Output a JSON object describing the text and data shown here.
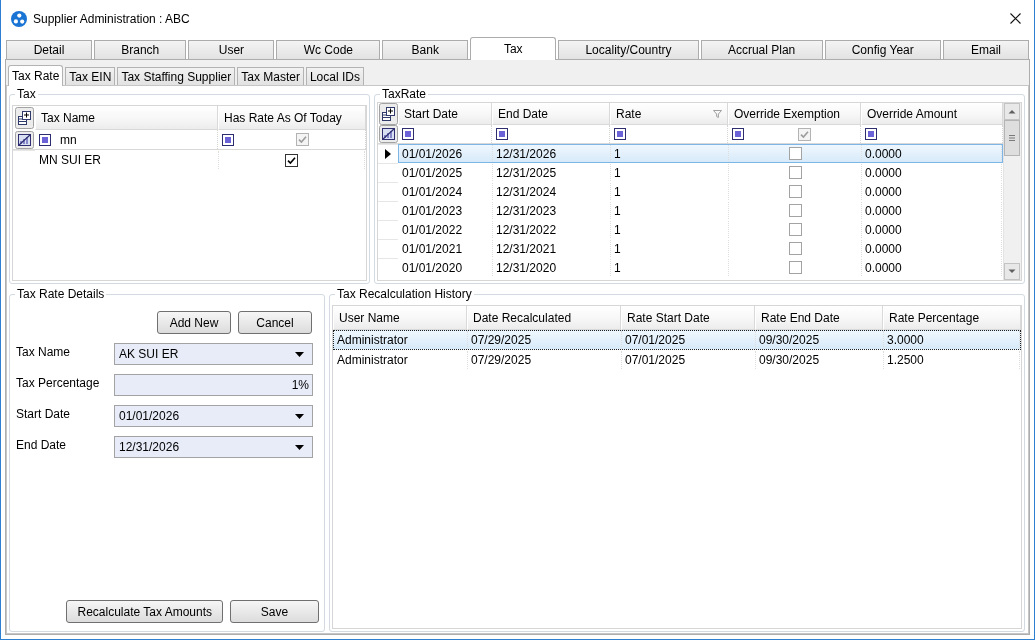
{
  "window": {
    "title": "Supplier Administration : ABC"
  },
  "tabs": [
    {
      "label": "Detail",
      "selected": false
    },
    {
      "label": "Branch",
      "selected": false
    },
    {
      "label": "User",
      "selected": false
    },
    {
      "label": "Wc Code",
      "selected": false
    },
    {
      "label": "Bank",
      "selected": false
    },
    {
      "label": "Tax",
      "selected": true
    },
    {
      "label": "Locality/Country",
      "selected": false
    },
    {
      "label": "Accrual Plan",
      "selected": false
    },
    {
      "label": "Config Year",
      "selected": false
    },
    {
      "label": "Email",
      "selected": false
    }
  ],
  "sub_tabs": [
    {
      "label": "Tax Rate",
      "selected": true
    },
    {
      "label": "Tax EIN",
      "selected": false
    },
    {
      "label": "Tax Staffing Supplier",
      "selected": false
    },
    {
      "label": "Tax Master",
      "selected": false
    },
    {
      "label": "Local IDs",
      "selected": false
    }
  ],
  "tax": {
    "title": "Tax",
    "grid": {
      "columns": [
        {
          "label": "Tax Name",
          "kind": "text",
          "filter_button": false
        },
        {
          "label": "Has Rate As Of Today",
          "kind": "checkbox",
          "filter_button": false
        }
      ],
      "filters": [
        {
          "kind": "text",
          "value": "mn"
        },
        {
          "kind": "checkbox",
          "checked": true
        }
      ],
      "rows": [
        {
          "selected": false,
          "cells": [
            "MN SUI ER",
            {
              "checked": true
            }
          ]
        }
      ]
    }
  },
  "tax_rate": {
    "title": "TaxRate",
    "grid": {
      "columns": [
        {
          "label": "Start Date",
          "kind": "text",
          "filter_button": false
        },
        {
          "label": "End Date",
          "kind": "text",
          "filter_button": false
        },
        {
          "label": "Rate",
          "kind": "text",
          "filter_button": true
        },
        {
          "label": "Override Exemption",
          "kind": "checkbox",
          "filter_button": false
        },
        {
          "label": "Override Amount",
          "kind": "text",
          "filter_button": false
        }
      ],
      "filters": [
        {
          "kind": "text"
        },
        {
          "kind": "text"
        },
        {
          "kind": "text"
        },
        {
          "kind": "checkbox",
          "checked": true
        },
        {
          "kind": "text"
        }
      ],
      "rows": [
        {
          "selected": true,
          "cells": [
            "01/01/2026",
            "12/31/2026",
            "1",
            {
              "checked": false
            },
            "0.0000"
          ]
        },
        {
          "selected": false,
          "cells": [
            "01/01/2025",
            "12/31/2025",
            "1",
            {
              "checked": false
            },
            "0.0000"
          ]
        },
        {
          "selected": false,
          "cells": [
            "01/01/2024",
            "12/31/2024",
            "1",
            {
              "checked": false
            },
            "0.0000"
          ]
        },
        {
          "selected": false,
          "cells": [
            "01/01/2023",
            "12/31/2023",
            "1",
            {
              "checked": false
            },
            "0.0000"
          ]
        },
        {
          "selected": false,
          "cells": [
            "01/01/2022",
            "12/31/2022",
            "1",
            {
              "checked": false
            },
            "0.0000"
          ]
        },
        {
          "selected": false,
          "cells": [
            "01/01/2021",
            "12/31/2021",
            "1",
            {
              "checked": false
            },
            "0.0000"
          ]
        },
        {
          "selected": false,
          "cells": [
            "01/01/2020",
            "12/31/2020",
            "1",
            {
              "checked": false
            },
            "0.0000"
          ]
        }
      ]
    }
  },
  "tax_rate_details": {
    "title": "Tax Rate Details",
    "buttons": [
      "Add New",
      "Cancel"
    ],
    "fields": [
      {
        "label": "Tax Name",
        "kind": "dropdown",
        "value": "AK SUI ER"
      },
      {
        "label": "Tax Percentage",
        "kind": "numeric",
        "value": "1%"
      },
      {
        "label": "Start Date",
        "kind": "dropdown",
        "value": "01/01/2026"
      },
      {
        "label": "End Date",
        "kind": "dropdown",
        "value": "12/31/2026"
      }
    ],
    "footer_buttons": [
      "Recalculate Tax Amounts",
      "Save"
    ]
  },
  "tax_recalculation_history": {
    "title": "Tax Recalculation History",
    "grid": {
      "columns": [
        {
          "label": "User Name",
          "kind": "text",
          "filter_button": false
        },
        {
          "label": "Date Recalculated",
          "kind": "text",
          "filter_button": false
        },
        {
          "label": "Rate Start Date",
          "kind": "text",
          "filter_button": false
        },
        {
          "label": "Rate End Date",
          "kind": "text",
          "filter_button": false
        },
        {
          "label": "Rate Percentage",
          "kind": "text",
          "filter_button": false
        }
      ],
      "rows": [
        {
          "selected": true,
          "cells": [
            "Administrator",
            "07/29/2025",
            "07/01/2025",
            "09/30/2025",
            "3.0000"
          ]
        },
        {
          "selected": false,
          "cells": [
            "Administrator",
            "07/29/2025",
            "07/01/2025",
            "09/30/2025",
            "1.2500"
          ]
        }
      ]
    }
  }
}
